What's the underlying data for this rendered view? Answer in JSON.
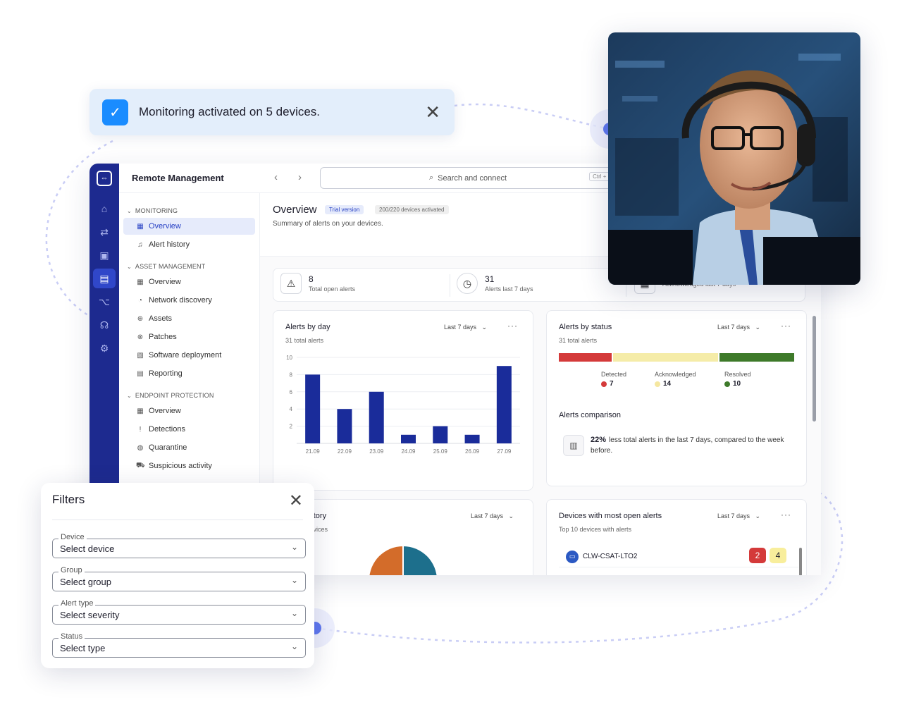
{
  "toast": {
    "message": "Monitoring activated on 5 devices."
  },
  "app": {
    "title": "Remote Management",
    "search": {
      "placeholder": "Search and connect",
      "shortcut": "Ctrl + K"
    },
    "sidebar": {
      "sections": [
        {
          "label": "MONITORING",
          "items": [
            {
              "label": "Overview",
              "icon": "grid-icon",
              "active": true
            },
            {
              "label": "Alert history",
              "icon": "bell-icon"
            }
          ]
        },
        {
          "label": "ASSET MANAGEMENT",
          "items": [
            {
              "label": "Overview",
              "icon": "grid-icon"
            },
            {
              "label": "Network discovery",
              "icon": "radar-icon"
            },
            {
              "label": "Assets",
              "icon": "globe-icon"
            },
            {
              "label": "Patches",
              "icon": "patch-icon"
            },
            {
              "label": "Software deployment",
              "icon": "package-icon"
            },
            {
              "label": "Reporting",
              "icon": "report-icon"
            }
          ]
        },
        {
          "label": "ENDPOINT PROTECTION",
          "items": [
            {
              "label": "Overview",
              "icon": "grid-icon"
            },
            {
              "label": "Detections",
              "icon": "exclamation-icon"
            },
            {
              "label": "Quarantine",
              "icon": "quarantine-icon"
            },
            {
              "label": "Suspicious activity",
              "icon": "car-icon"
            }
          ]
        }
      ]
    },
    "page": {
      "title": "Overview",
      "badge_trial": "Trial version",
      "badge_devices": "200/220 devices activated",
      "subtitle": "Summary of alerts on your devices."
    },
    "stats": [
      {
        "value": "8",
        "label": "Total open alerts",
        "icon": "warning-icon"
      },
      {
        "value": "31",
        "label": "Alerts last 7 days",
        "icon": "clock-icon"
      },
      {
        "value": "",
        "label": "Acknowledged last 7 days",
        "icon": "calendar-icon"
      }
    ],
    "alerts_by_day": {
      "title": "Alerts by day",
      "subtitle": "31 total alerts",
      "range": "Last 7 days"
    },
    "alerts_by_status": {
      "title": "Alerts by status",
      "subtitle": "31 total alerts",
      "range": "Last 7 days",
      "statuses": [
        {
          "label": "Detected",
          "value": 7,
          "color": "#d43a3a",
          "bar_color": "#d43a3a"
        },
        {
          "label": "Acknowledged",
          "value": 14,
          "color": "#f5e7a0",
          "bar_color": "#f5eca8"
        },
        {
          "label": "Resolved",
          "value": 10,
          "color": "#3e7a2a",
          "bar_color": "#3e7a2a"
        }
      ],
      "comparison_title": "Alerts comparison",
      "comparison_pct": "22%",
      "comparison_text": "less total alerts in the last 7 days, compared to the week before."
    },
    "alert_history": {
      "title": "Alert history",
      "subtitle": "Top 10 devices",
      "range": "Last 7 days"
    },
    "devices_most_alerts": {
      "title": "Devices with most open alerts",
      "subtitle": "Top 10 devices with alerts",
      "range": "Last 7 days",
      "rows": [
        {
          "name": "CLW-CSAT-LTO2",
          "critical": "2",
          "warning": "4"
        }
      ]
    }
  },
  "filters": {
    "title": "Filters",
    "fields": [
      {
        "label": "Device",
        "value": "Select device"
      },
      {
        "label": "Group",
        "value": "Select group"
      },
      {
        "label": "Alert type",
        "value": "Select severity"
      },
      {
        "label": "Status",
        "value": "Select type"
      }
    ]
  },
  "colors": {
    "accent": "#1d2a8f",
    "bar": "#1a2c9a",
    "toast_bg": "#e3eefb",
    "check": "#1a8cff",
    "pie_orange": "#d36c2a",
    "pie_teal": "#1d6f8c"
  },
  "chart_data": {
    "type": "bar",
    "title": "Alerts by day",
    "categories": [
      "21.09",
      "22.09",
      "23.09",
      "24.09",
      "25.09",
      "26.09",
      "27.09"
    ],
    "values": [
      8,
      4,
      6,
      1,
      2,
      1,
      9
    ],
    "ylim": [
      0,
      10
    ],
    "yticks": [
      2,
      4,
      6,
      8,
      10
    ],
    "grid": true
  }
}
